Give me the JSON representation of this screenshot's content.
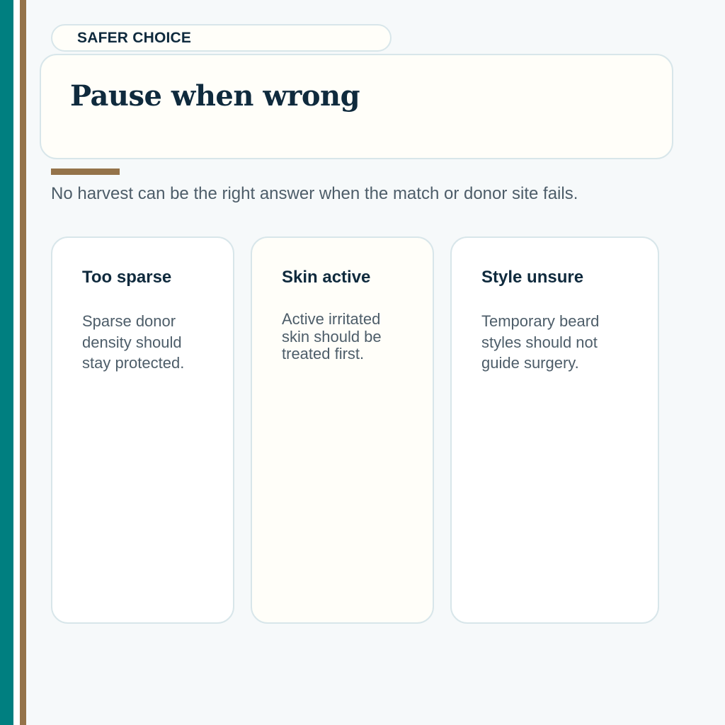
{
  "kicker": "SAFER CHOICE",
  "title": "Pause when wrong",
  "lede": "No harvest can be the right answer when the match or donor site fails.",
  "cards": [
    {
      "title": "Too sparse",
      "body": "Sparse donor density should stay protected."
    },
    {
      "title": "Skin active",
      "body": "Active irritated skin should be treated first."
    },
    {
      "title": "Style unsure",
      "body": "Temporary beard styles should not guide surgery."
    }
  ],
  "colors": {
    "teal": "#007f80",
    "brown": "#94734a",
    "navy": "#0f2a3d",
    "muted": "#4d5d69",
    "cream": "#fffef9",
    "border": "#d8e6ea"
  }
}
